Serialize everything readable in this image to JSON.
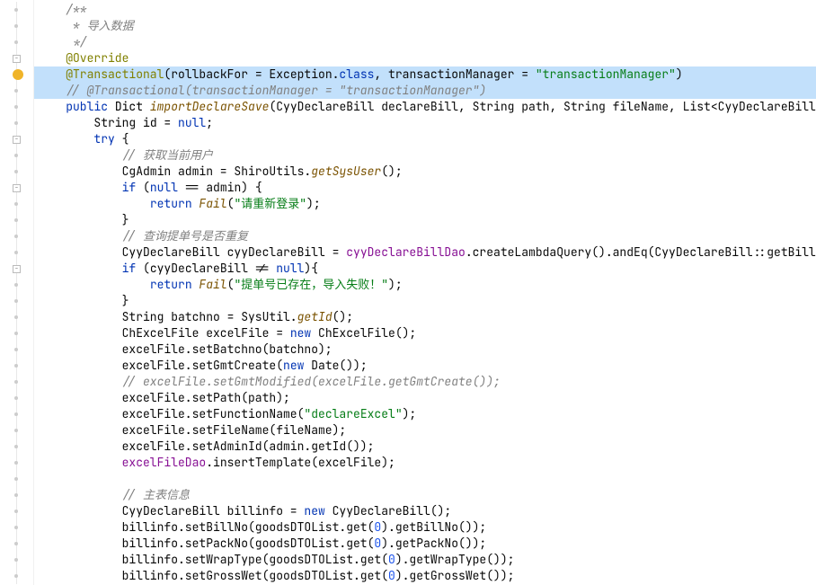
{
  "lines": [
    {
      "indent": 1,
      "spans": [
        {
          "cls": "c-comment",
          "t": "/**"
        }
      ],
      "gutter": "dot"
    },
    {
      "indent": 1,
      "spans": [
        {
          "cls": "c-comment",
          "t": " * 导入数据"
        }
      ],
      "gutter": "dot"
    },
    {
      "indent": 1,
      "spans": [
        {
          "cls": "c-comment",
          "t": " */"
        }
      ],
      "gutter": "dot"
    },
    {
      "indent": 1,
      "spans": [
        {
          "cls": "c-annotation",
          "t": "@Override"
        }
      ],
      "gutter": "fold"
    },
    {
      "indent": 1,
      "highlight": true,
      "spans": [
        {
          "cls": "c-annotation",
          "t": "@Transactional"
        },
        {
          "cls": "",
          "t": "("
        },
        {
          "cls": "",
          "t": "rollbackFor = Exception."
        },
        {
          "cls": "c-keyword",
          "t": "class"
        },
        {
          "cls": "",
          "t": ", transactionManager = "
        },
        {
          "cls": "c-string",
          "t": "\"transactionManager\""
        },
        {
          "cls": "",
          "t": ")"
        }
      ],
      "gutter": "bulb"
    },
    {
      "indent": 1,
      "highlight": true,
      "spans": [
        {
          "cls": "c-comment",
          "t": "// @Transactional(transactionManager = \"transactionManager\")"
        }
      ],
      "gutter": "dot"
    },
    {
      "indent": 1,
      "spans": [
        {
          "cls": "c-keyword",
          "t": "public "
        },
        {
          "cls": "c-type",
          "t": "Dict "
        },
        {
          "cls": "c-method",
          "t": "importDeclareSave"
        },
        {
          "cls": "",
          "t": "(CyyDeclareBill declareBill, String path, String fileName, List<CyyDeclareBillG"
        }
      ],
      "gutter": "dot"
    },
    {
      "indent": 2,
      "spans": [
        {
          "cls": "",
          "t": "String "
        },
        {
          "cls": "c-param",
          "t": "id"
        },
        {
          "cls": "",
          "t": " = "
        },
        {
          "cls": "c-keyword",
          "t": "null"
        },
        {
          "cls": "",
          "t": ";"
        }
      ],
      "gutter": "dot"
    },
    {
      "indent": 2,
      "spans": [
        {
          "cls": "c-keyword",
          "t": "try "
        },
        {
          "cls": "",
          "t": "{"
        }
      ],
      "gutter": "fold"
    },
    {
      "indent": 3,
      "spans": [
        {
          "cls": "c-comment",
          "t": "// 获取当前用户"
        }
      ],
      "gutter": "dot"
    },
    {
      "indent": 3,
      "spans": [
        {
          "cls": "",
          "t": "CgAdmin admin = ShiroUtils."
        },
        {
          "cls": "c-method",
          "t": "getSysUser"
        },
        {
          "cls": "",
          "t": "();"
        }
      ],
      "gutter": "dot"
    },
    {
      "indent": 3,
      "spans": [
        {
          "cls": "c-keyword",
          "t": "if "
        },
        {
          "cls": "",
          "t": "("
        },
        {
          "cls": "c-keyword",
          "t": "null "
        },
        {
          "cls": "",
          "t": "== admin) {"
        }
      ],
      "gutter": "fold"
    },
    {
      "indent": 4,
      "spans": [
        {
          "cls": "c-keyword",
          "t": "return "
        },
        {
          "cls": "c-method",
          "t": "Fail"
        },
        {
          "cls": "",
          "t": "("
        },
        {
          "cls": "c-string",
          "t": "\"请重新登录\""
        },
        {
          "cls": "",
          "t": ");"
        }
      ],
      "gutter": "dot"
    },
    {
      "indent": 3,
      "spans": [
        {
          "cls": "",
          "t": "}"
        }
      ],
      "gutter": "dot"
    },
    {
      "indent": 3,
      "spans": [
        {
          "cls": "c-comment",
          "t": "// 查询提单号是否重复"
        }
      ],
      "gutter": "dot"
    },
    {
      "indent": 3,
      "spans": [
        {
          "cls": "",
          "t": "CyyDeclareBill cyyDeclareBill = "
        },
        {
          "cls": "c-field",
          "t": "cyyDeclareBillDao"
        },
        {
          "cls": "",
          "t": ".createLambdaQuery().andEq(CyyDeclareBill::getBillN"
        }
      ],
      "gutter": "dot"
    },
    {
      "indent": 3,
      "spans": [
        {
          "cls": "c-keyword",
          "t": "if "
        },
        {
          "cls": "",
          "t": "(cyyDeclareBill != "
        },
        {
          "cls": "c-keyword",
          "t": "null"
        },
        {
          "cls": "",
          "t": "){"
        }
      ],
      "gutter": "fold"
    },
    {
      "indent": 4,
      "spans": [
        {
          "cls": "c-keyword",
          "t": "return "
        },
        {
          "cls": "c-method",
          "t": "Fail"
        },
        {
          "cls": "",
          "t": "("
        },
        {
          "cls": "c-string",
          "t": "\"提单号已存在，导入失败！\""
        },
        {
          "cls": "",
          "t": ");"
        }
      ],
      "gutter": "dot"
    },
    {
      "indent": 3,
      "spans": [
        {
          "cls": "",
          "t": "}"
        }
      ],
      "gutter": "dot"
    },
    {
      "indent": 3,
      "spans": [
        {
          "cls": "",
          "t": "String batchno = SysUtil."
        },
        {
          "cls": "c-method",
          "t": "getId"
        },
        {
          "cls": "",
          "t": "();"
        }
      ],
      "gutter": "dot"
    },
    {
      "indent": 3,
      "spans": [
        {
          "cls": "",
          "t": "ChExcelFile excelFile = "
        },
        {
          "cls": "c-keyword",
          "t": "new "
        },
        {
          "cls": "",
          "t": "ChExcelFile();"
        }
      ],
      "gutter": "dot"
    },
    {
      "indent": 3,
      "spans": [
        {
          "cls": "",
          "t": "excelFile.setBatchno(batchno);"
        }
      ],
      "gutter": "dot"
    },
    {
      "indent": 3,
      "spans": [
        {
          "cls": "",
          "t": "excelFile.setGmtCreate("
        },
        {
          "cls": "c-keyword",
          "t": "new "
        },
        {
          "cls": "",
          "t": "Date());"
        }
      ],
      "gutter": "dot"
    },
    {
      "indent": 3,
      "spans": [
        {
          "cls": "c-comment",
          "t": "// excelFile.setGmtModified(excelFile.getGmtCreate());"
        }
      ],
      "gutter": "dot"
    },
    {
      "indent": 3,
      "spans": [
        {
          "cls": "",
          "t": "excelFile.setPath(path);"
        }
      ],
      "gutter": "dot"
    },
    {
      "indent": 3,
      "spans": [
        {
          "cls": "",
          "t": "excelFile.setFunctionName("
        },
        {
          "cls": "c-string",
          "t": "\"declareExcel\""
        },
        {
          "cls": "",
          "t": ");"
        }
      ],
      "gutter": "dot"
    },
    {
      "indent": 3,
      "spans": [
        {
          "cls": "",
          "t": "excelFile.setFileName(fileName);"
        }
      ],
      "gutter": "dot"
    },
    {
      "indent": 3,
      "spans": [
        {
          "cls": "",
          "t": "excelFile.setAdminId(admin.getId());"
        }
      ],
      "gutter": "dot"
    },
    {
      "indent": 3,
      "spans": [
        {
          "cls": "c-field",
          "t": "excelFileDao"
        },
        {
          "cls": "",
          "t": ".insertTemplate(excelFile);"
        }
      ],
      "gutter": "dot"
    },
    {
      "indent": 3,
      "spans": [],
      "gutter": "dot"
    },
    {
      "indent": 3,
      "spans": [
        {
          "cls": "c-comment",
          "t": "// 主表信息"
        }
      ],
      "gutter": "dot"
    },
    {
      "indent": 3,
      "spans": [
        {
          "cls": "",
          "t": "CyyDeclareBill billinfo = "
        },
        {
          "cls": "c-keyword",
          "t": "new "
        },
        {
          "cls": "",
          "t": "CyyDeclareBill();"
        }
      ],
      "gutter": "dot"
    },
    {
      "indent": 3,
      "spans": [
        {
          "cls": "",
          "t": "billinfo.setBillNo(goodsDTOList.get("
        },
        {
          "cls": "c-number",
          "t": "0"
        },
        {
          "cls": "",
          "t": ").getBillNo());"
        }
      ],
      "gutter": "dot"
    },
    {
      "indent": 3,
      "spans": [
        {
          "cls": "",
          "t": "billinfo.setPackNo(goodsDTOList.get("
        },
        {
          "cls": "c-number",
          "t": "0"
        },
        {
          "cls": "",
          "t": ").getPackNo());"
        }
      ],
      "gutter": "dot"
    },
    {
      "indent": 3,
      "spans": [
        {
          "cls": "",
          "t": "billinfo.setWrapType(goodsDTOList.get("
        },
        {
          "cls": "c-number",
          "t": "0"
        },
        {
          "cls": "",
          "t": ").getWrapType());"
        }
      ],
      "gutter": "dot"
    },
    {
      "indent": 3,
      "spans": [
        {
          "cls": "",
          "t": "billinfo.setGrossWet(goodsDTOList.get("
        },
        {
          "cls": "c-number",
          "t": "0"
        },
        {
          "cls": "",
          "t": ").getGrossWet());"
        }
      ],
      "gutter": "dot"
    }
  ]
}
